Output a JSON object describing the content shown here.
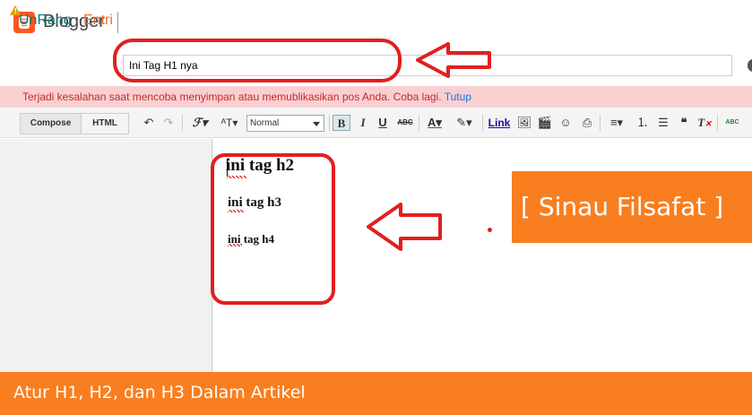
{
  "app": {
    "brand": "Blogger"
  },
  "post": {
    "blog_name": "UnRang",
    "separator": "·",
    "section": "Entri",
    "title_value": "Ini Tag H1 nya"
  },
  "error": {
    "message": "Terjadi kesalahan saat mencoba menyimpan atau memublikasikan pos Anda. Coba lagi.",
    "dismiss": "Tutup",
    "color": "#c62828"
  },
  "toolbar": {
    "tab_compose": "Compose",
    "tab_html": "HTML",
    "format_select": "Normal",
    "bold": "B",
    "italic": "I",
    "underline": "U",
    "strike": "ABC",
    "text_color": "A",
    "link": "Link",
    "quote": "❝",
    "spell": "ABC"
  },
  "editor": {
    "h2": "ini tag h2",
    "h3": "ini tag h3",
    "h4": "ini tag h4"
  },
  "overlay": {
    "watermark": "[ Sinau Filsafat ]",
    "caption": "Atur H1, H2, dan H3 Dalam Artikel",
    "accent": "#f97e1f",
    "annotation_color": "#e02020"
  }
}
